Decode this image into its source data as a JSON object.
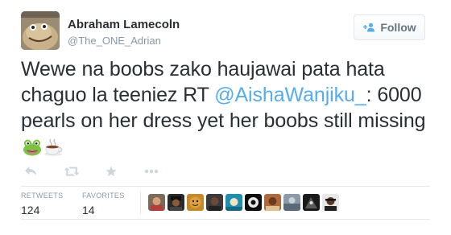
{
  "user": {
    "display_name": "Abraham Lamecoln",
    "handle": "@The_ONE_Adrian"
  },
  "follow_button": {
    "label": "Follow",
    "icon": "add-user-icon"
  },
  "tweet": {
    "text_before": "Wewe na boobs zako haujawai pata hata chaguo la teeniez RT ",
    "mention": "@AishaWanjiku_",
    "text_after": ": 6000 pearls on her dress yet her boobs still missing",
    "emojis": [
      "frog-face-emoji",
      "coffee-cup-emoji"
    ]
  },
  "actions": [
    "reply-icon",
    "retweet-icon",
    "favorite-star-icon",
    "more-dots-icon"
  ],
  "stats": {
    "retweets_label": "RETWEETS",
    "retweets_value": "124",
    "favorites_label": "FAVORITES",
    "favorites_value": "14"
  },
  "favoriter_avatars_count": 9,
  "colors": {
    "text": "#292f33",
    "muted": "#8899a6",
    "link": "#55acee",
    "action_icons": "#ccd6dd",
    "divider": "#e1e8ed"
  }
}
